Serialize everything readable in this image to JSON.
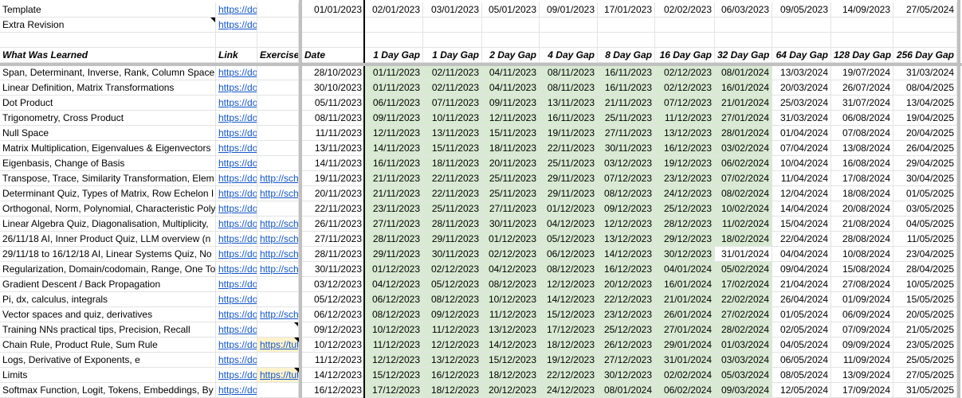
{
  "rows": [
    {
      "learned": "Template",
      "link": "https://do",
      "exercise": "",
      "date": "",
      "gaps": [
        "01/01/2023",
        "02/01/2023",
        "03/01/2023",
        "05/01/2023",
        "09/01/2023",
        "17/01/2023",
        "02/02/2023",
        "06/03/2023",
        "09/05/2023",
        "14/09/2023",
        "27/05/2024"
      ]
    },
    {
      "learned": "Extra Revision",
      "link": "https://do",
      "exercise": "",
      "date": "",
      "gaps": [
        "",
        "",
        "",
        "",
        "",
        "",
        "",
        "",
        "",
        "",
        ""
      ]
    },
    {
      "learned": "",
      "link": "",
      "exercise": "",
      "date": "",
      "gaps": [
        "",
        "",
        "",
        "",
        "",
        "",
        "",
        "",
        "",
        "",
        ""
      ]
    },
    {
      "learned": "What Was Learned",
      "link": "Link",
      "exercise": "Exercise",
      "date": "Date",
      "gaps": [
        "1 Day Gap",
        "1 Day Gap",
        "2 Day Gap",
        "4 Day Gap",
        "8 Day Gap",
        "16 Day Gap",
        "32 Day Gap",
        "64 Day Gap",
        "128 Day Gap",
        "256 Day Gap"
      ]
    },
    {
      "learned": "Span, Determinant, Inverse, Rank, Column Space",
      "link": "https://do",
      "exercise": "",
      "date": "28/10/2023",
      "gaps": [
        "01/11/2023",
        "02/11/2023",
        "04/11/2023",
        "08/11/2023",
        "16/11/2023",
        "02/12/2023",
        "08/01/2024",
        "13/03/2024",
        "19/07/2024",
        "31/03/2024"
      ]
    },
    {
      "learned": "Linear Definition, Matrix Transformations",
      "link": "https://do",
      "exercise": "",
      "date": "30/10/2023",
      "gaps": [
        "01/11/2023",
        "02/11/2023",
        "04/11/2023",
        "08/11/2023",
        "16/11/2023",
        "02/12/2023",
        "16/01/2024",
        "20/03/2024",
        "26/07/2024",
        "08/04/2025"
      ]
    },
    {
      "learned": "Dot Product",
      "link": "https://do",
      "exercise": "",
      "date": "05/11/2023",
      "gaps": [
        "06/11/2023",
        "07/11/2023",
        "09/11/2023",
        "13/11/2023",
        "21/11/2023",
        "07/12/2023",
        "21/01/2024",
        "25/03/2024",
        "31/07/2024",
        "13/04/2025"
      ]
    },
    {
      "learned": "Trigonometry, Cross Product",
      "link": "https://do",
      "exercise": "",
      "date": "08/11/2023",
      "gaps": [
        "09/11/2023",
        "10/11/2023",
        "12/11/2023",
        "16/11/2023",
        "25/11/2023",
        "11/12/2023",
        "27/01/2024",
        "31/03/2024",
        "06/08/2024",
        "19/04/2025"
      ]
    },
    {
      "learned": "Null Space",
      "link": "https://do",
      "exercise": "",
      "date": "11/11/2023",
      "gaps": [
        "12/11/2023",
        "13/11/2023",
        "15/11/2023",
        "19/11/2023",
        "27/11/2023",
        "13/12/2023",
        "28/01/2024",
        "01/04/2024",
        "07/08/2024",
        "20/04/2025"
      ]
    },
    {
      "learned": "Matrix Multiplication, Eigenvalues & Eigenvectors",
      "link": "https://do",
      "exercise": "",
      "date": "13/11/2023",
      "gaps": [
        "14/11/2023",
        "15/11/2023",
        "18/11/2023",
        "22/11/2023",
        "30/11/2023",
        "16/12/2023",
        "03/02/2024",
        "07/04/2024",
        "13/08/2024",
        "26/04/2025"
      ]
    },
    {
      "learned": "Eigenbasis, Change of Basis",
      "link": "https://do",
      "exercise": "",
      "date": "14/11/2023",
      "gaps": [
        "16/11/2023",
        "18/11/2023",
        "20/11/2023",
        "25/11/2023",
        "03/12/2023",
        "19/12/2023",
        "06/02/2024",
        "10/04/2024",
        "16/08/2024",
        "29/04/2025"
      ]
    },
    {
      "learned": "Transpose, Trace, Similarity Transformation, Elem",
      "link": "https://do",
      "exercise": "http://sch",
      "date": "19/11/2023",
      "gaps": [
        "21/11/2023",
        "22/11/2023",
        "25/11/2023",
        "29/11/2023",
        "07/12/2023",
        "23/12/2023",
        "07/02/2024",
        "11/04/2024",
        "17/08/2024",
        "30/04/2025"
      ]
    },
    {
      "learned": "Determinant Quiz, Types of Matrix, Row Echelon I",
      "link": "https://do",
      "exercise": "http://sch",
      "date": "20/11/2023",
      "gaps": [
        "21/11/2023",
        "22/11/2023",
        "25/11/2023",
        "29/11/2023",
        "08/12/2023",
        "24/12/2023",
        "08/02/2024",
        "12/04/2024",
        "18/08/2024",
        "01/05/2025"
      ]
    },
    {
      "learned": "Orthogonal, Norm, Polynomial, Characteristic Poly",
      "link": "https://do",
      "exercise": "",
      "date": "22/11/2023",
      "gaps": [
        "23/11/2023",
        "25/11/2023",
        "27/11/2023",
        "01/12/2023",
        "09/12/2023",
        "25/12/2023",
        "10/02/2024",
        "14/04/2024",
        "20/08/2024",
        "03/05/2025"
      ]
    },
    {
      "learned": "Linear Algebra Quiz, Diagonalisation, Multiplicity,",
      "link": "https://do",
      "exercise": "http://sch",
      "date": "26/11/2023",
      "gaps": [
        "27/11/2023",
        "28/11/2023",
        "30/11/2023",
        "04/12/2023",
        "12/12/2023",
        "28/12/2023",
        "11/02/2024",
        "15/04/2024",
        "21/08/2024",
        "04/05/2025"
      ]
    },
    {
      "learned": "26/11/18 AI, Inner Product Quiz, LLM overview (n",
      "link": "https://do",
      "exercise": "http://sch",
      "date": "27/11/2023",
      "gaps": [
        "28/11/2023",
        "29/11/2023",
        "01/12/2023",
        "05/12/2023",
        "13/12/2023",
        "29/12/2023",
        "18/02/2024",
        "22/04/2024",
        "28/08/2024",
        "11/05/2025"
      ]
    },
    {
      "learned": "29/11/18 to 16/12/18 AI, Linear Systems Quiz, No",
      "link": "https://do",
      "exercise": "http://sch",
      "date": "28/11/2023",
      "gaps": [
        "29/11/2023",
        "30/11/2023",
        "02/12/2023",
        "06/12/2023",
        "14/12/2023",
        "30/12/2023",
        "31/01/2024",
        "04/04/2024",
        "10/08/2024",
        "23/04/2025"
      ]
    },
    {
      "learned": "Regularization, Domain/codomain, Range, One To",
      "link": "https://do",
      "exercise": "http://sch",
      "date": "30/11/2023",
      "gaps": [
        "01/12/2023",
        "02/12/2023",
        "04/12/2023",
        "08/12/2023",
        "16/12/2023",
        "04/01/2024",
        "05/02/2024",
        "09/04/2024",
        "15/08/2024",
        "28/04/2025"
      ]
    },
    {
      "learned": "Gradient Descent / Back Propagation",
      "link": "https://do",
      "exercise": "",
      "date": "03/12/2023",
      "gaps": [
        "04/12/2023",
        "05/12/2023",
        "08/12/2023",
        "12/12/2023",
        "20/12/2023",
        "16/01/2024",
        "17/02/2024",
        "21/04/2024",
        "27/08/2024",
        "10/05/2025"
      ]
    },
    {
      "learned": "Pi, dx, calculus, integrals",
      "link": "https://do",
      "exercise": "",
      "date": "05/12/2023",
      "gaps": [
        "06/12/2023",
        "08/12/2023",
        "10/12/2023",
        "14/12/2023",
        "22/12/2023",
        "21/01/2024",
        "22/02/2024",
        "26/04/2024",
        "01/09/2024",
        "15/05/2025"
      ]
    },
    {
      "learned": "Vector spaces and quiz, derivatives",
      "link": "https://do",
      "exercise": "http://sch",
      "date": "06/12/2023",
      "gaps": [
        "08/12/2023",
        "09/12/2023",
        "11/12/2023",
        "15/12/2023",
        "23/12/2023",
        "26/01/2024",
        "27/02/2024",
        "01/05/2024",
        "06/09/2024",
        "20/05/2025"
      ]
    },
    {
      "learned": "Training NNs practical tips, Precision, Recall",
      "link": "https://do",
      "exercise": "",
      "date": "09/12/2023",
      "gaps": [
        "10/12/2023",
        "11/12/2023",
        "13/12/2023",
        "17/12/2023",
        "25/12/2023",
        "27/01/2024",
        "28/02/2024",
        "02/05/2024",
        "07/09/2024",
        "21/05/2025"
      ]
    },
    {
      "learned": "Chain Rule, Product Rule, Sum Rule",
      "link": "https://do",
      "exercise": "https://tut",
      "date": "10/12/2023",
      "gaps": [
        "11/12/2023",
        "12/12/2023",
        "14/12/2023",
        "18/12/2023",
        "26/12/2023",
        "29/01/2024",
        "01/03/2024",
        "04/05/2024",
        "09/09/2024",
        "23/05/2025"
      ]
    },
    {
      "learned": "Logs, Derivative of Exponents, e",
      "link": "https://do",
      "exercise": "",
      "date": "11/12/2023",
      "gaps": [
        "12/12/2023",
        "13/12/2023",
        "15/12/2023",
        "19/12/2023",
        "27/12/2023",
        "31/01/2024",
        "03/03/2024",
        "06/05/2024",
        "11/09/2024",
        "25/05/2025"
      ]
    },
    {
      "learned": "Limits",
      "link": "https://do",
      "exercise": "https://tut",
      "date": "14/12/2023",
      "gaps": [
        "15/12/2023",
        "16/12/2023",
        "18/12/2023",
        "22/12/2023",
        "30/12/2023",
        "02/02/2024",
        "05/03/2024",
        "08/05/2024",
        "13/09/2024",
        "27/05/2025"
      ]
    },
    {
      "learned": "Softmax Function, Logit, Tokens, Embeddings, By",
      "link": "https://do",
      "exercise": "",
      "date": "16/12/2023",
      "gaps": [
        "17/12/2023",
        "18/12/2023",
        "20/12/2023",
        "24/12/2023",
        "08/01/2024",
        "06/02/2024",
        "09/03/2024",
        "12/05/2024",
        "17/09/2024",
        "31/05/2025"
      ]
    }
  ],
  "colors": {
    "green_fill": "#d9ead3",
    "link": "#1155cc",
    "yellow_fill": "#fff2cc"
  }
}
